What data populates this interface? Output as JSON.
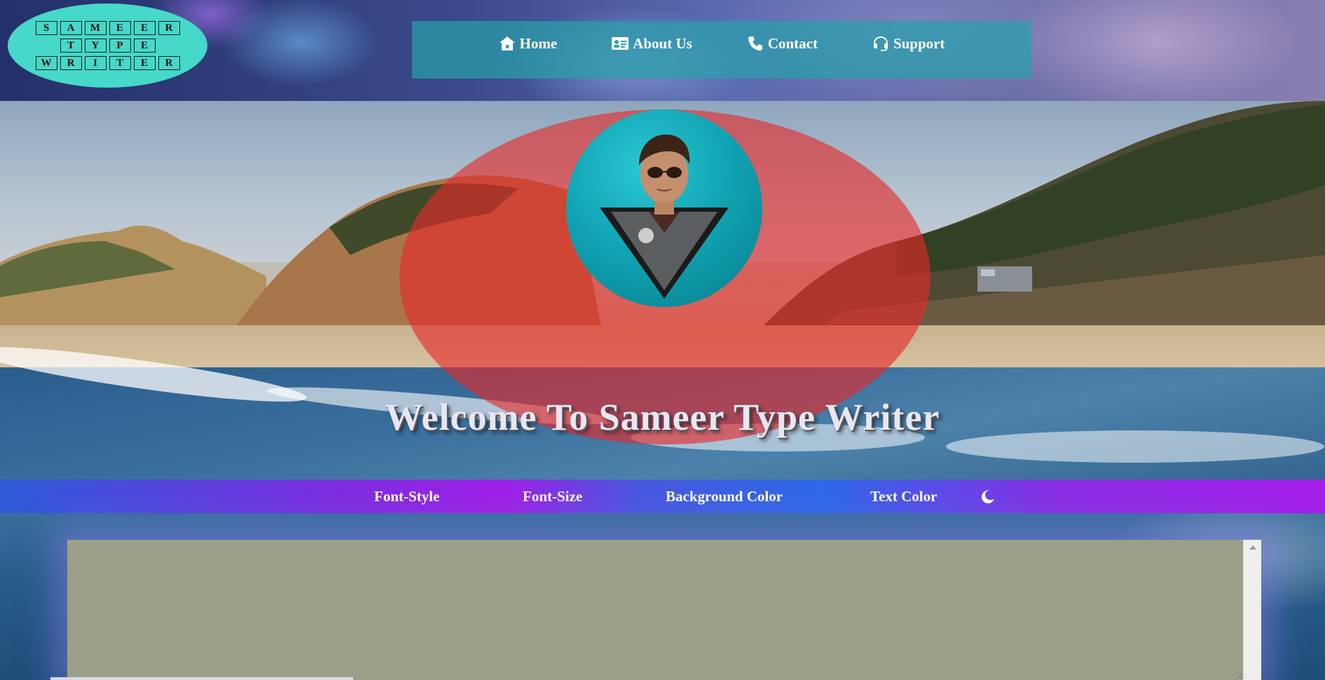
{
  "logo": {
    "rows": [
      [
        "S",
        "A",
        "M",
        "E",
        "E",
        "R"
      ],
      [
        "T",
        "Y",
        "P",
        "E"
      ],
      [
        "W",
        "R",
        "I",
        "T",
        "E",
        "R"
      ]
    ]
  },
  "nav": {
    "items": [
      {
        "label": "Home",
        "icon": "house-icon"
      },
      {
        "label": "About Us",
        "icon": "id-card-icon"
      },
      {
        "label": "Contact",
        "icon": "phone-icon"
      },
      {
        "label": "Support",
        "icon": "headset-icon"
      }
    ]
  },
  "hero": {
    "welcome": "Welcome To Sameer Type Writer"
  },
  "toolbar": {
    "font_style": "Font-Style",
    "font_size": "Font-Size",
    "background_color": "Background Color",
    "text_color": "Text Color",
    "theme_icon": "moon-icon"
  },
  "editor": {
    "value": ""
  },
  "colors": {
    "logo_bg": "#46d8c8",
    "nav_bg": "#28a0aa",
    "hero_oval": "#e62828",
    "avatar_bg": "#11a5b4",
    "toolbar_start": "#2d5bd8",
    "toolbar_accent": "#a020e6",
    "editor_bg": "#9c9f88"
  }
}
